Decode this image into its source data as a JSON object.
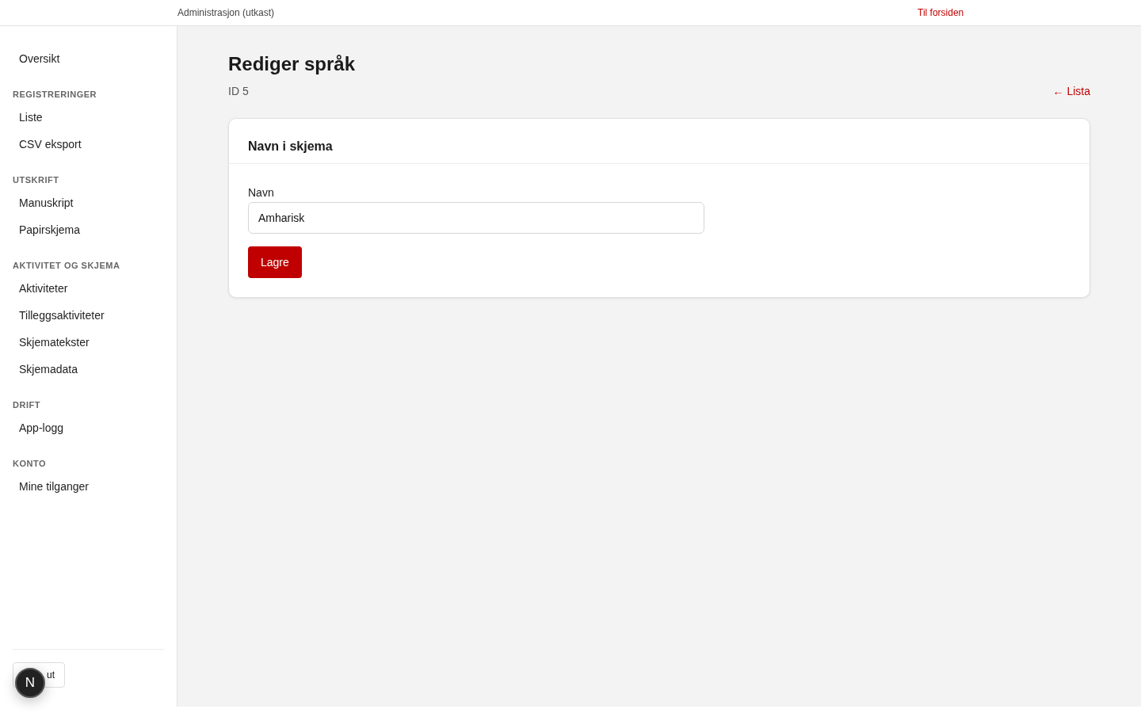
{
  "topbar": {
    "title": "Administrasjon (utkast)",
    "home_link": "Til forsiden"
  },
  "sidebar": {
    "sections": [
      {
        "items": [
          {
            "label": "Oversikt",
            "selected": false
          }
        ]
      },
      {
        "heading": "REGISTRERINGER",
        "items": [
          {
            "label": "Liste",
            "selected": false
          },
          {
            "label": "CSV eksport",
            "selected": false
          }
        ]
      },
      {
        "heading": "UTSKRIFT",
        "items": [
          {
            "label": "Manuskript",
            "selected": false
          },
          {
            "label": "Papirskjema",
            "selected": false
          }
        ]
      },
      {
        "heading": "AKTIVITET OG SKJEMA",
        "items": [
          {
            "label": "Aktiviteter",
            "selected": false
          },
          {
            "label": "Tilleggsaktiviteter",
            "selected": false
          },
          {
            "label": "Skjematekster",
            "selected": false
          },
          {
            "label": "Skjemadata",
            "selected": false
          }
        ]
      },
      {
        "heading": "DRIFT",
        "items": [
          {
            "label": "App-logg",
            "selected": false
          }
        ]
      },
      {
        "heading": "KONTO",
        "items": [
          {
            "label": "Mine tilganger",
            "selected": false
          }
        ]
      }
    ],
    "logout_button": "ut",
    "dev_badge": "N"
  },
  "page": {
    "title": "Rediger språk",
    "subtitle": "ID 5",
    "back_link": "← Lista"
  },
  "card": {
    "title": "Navn i skjema",
    "field": {
      "label": "Navn",
      "value": "Amharisk"
    },
    "save_button": "Lagre"
  }
}
